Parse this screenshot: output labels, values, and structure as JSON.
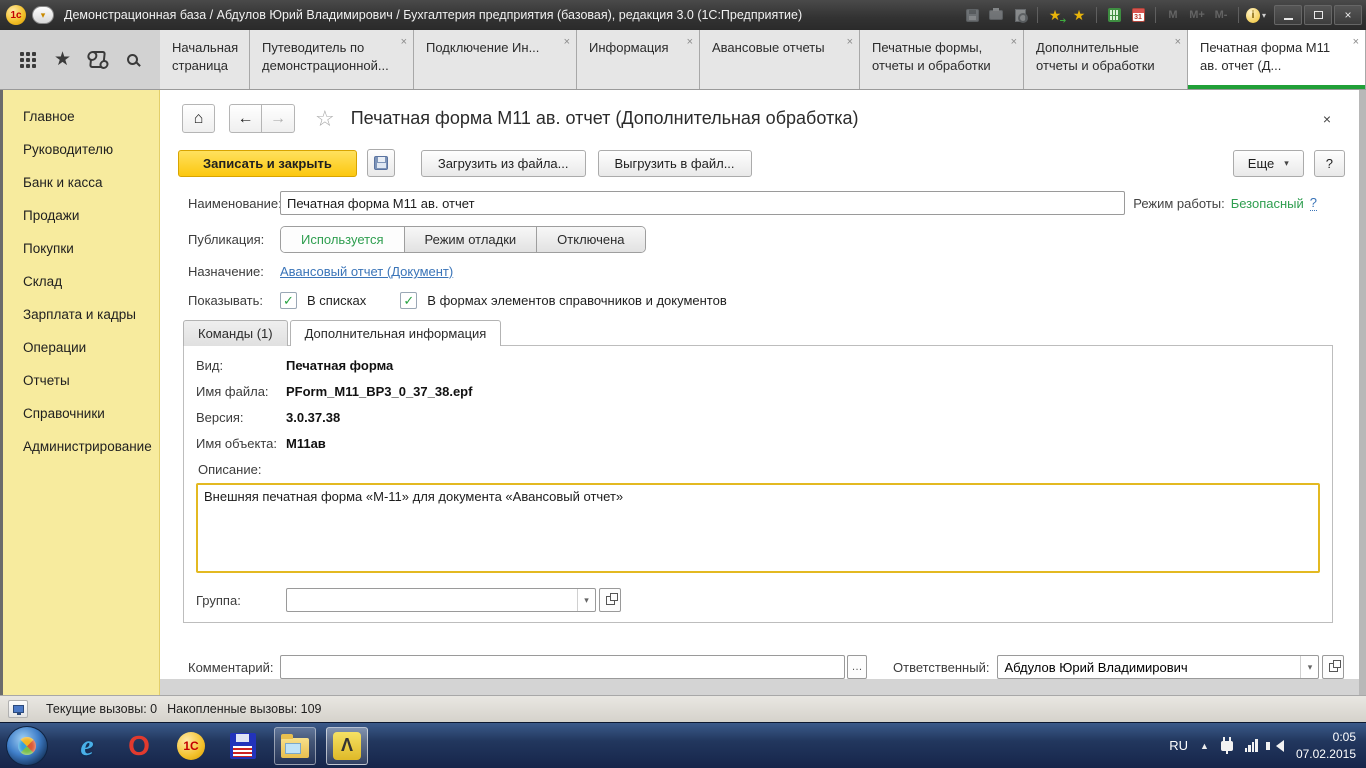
{
  "colors": {
    "accent_green": "#21a038",
    "sidebar_yellow": "#f7eb9e",
    "primary_button_yellow": "#fcc80f",
    "link_blue": "#3a74b8"
  },
  "icons": {
    "close": "×",
    "dropdown_caret": "▾",
    "back": "←",
    "forward": "→",
    "home": "⌂",
    "star": "★",
    "star_outline": "☆",
    "check": "✓",
    "info": "i",
    "calendar_day": "31",
    "ellipsis": "…",
    "question": "?"
  },
  "titlebar": {
    "title": "Демонстрационная база / Абдулов Юрий Владимирович / Бухгалтерия предприятия (базовая), редакция 3.0  (1С:Предприятие)",
    "logo": "1с",
    "memory_buttons": [
      "M",
      "M+",
      "M-"
    ]
  },
  "tabbar": {
    "tabs": [
      {
        "label": "Начальная страница"
      },
      {
        "label": "Путеводитель по демонстрационной..."
      },
      {
        "label": "Подключение Ин..."
      },
      {
        "label": "Информация"
      },
      {
        "label": "Авансовые отчеты"
      },
      {
        "label": "Печатные формы, отчеты и обработки"
      },
      {
        "label": "Дополнительные отчеты и обработки"
      },
      {
        "label": "Печатная форма М11 ав. отчет (Д..."
      }
    ]
  },
  "sidebar": {
    "items": [
      "Главное",
      "Руководителю",
      "Банк и касса",
      "Продажи",
      "Покупки",
      "Склад",
      "Зарплата и кадры",
      "Операции",
      "Отчеты",
      "Справочники",
      "Администрирование"
    ]
  },
  "form": {
    "title": "Печатная форма М11 ав. отчет (Дополнительная обработка)",
    "toolbar": {
      "save_close": "Записать и закрыть",
      "load_from_file": "Загрузить из файла...",
      "unload_to_file": "Выгрузить в файл...",
      "more": "Еще",
      "help": "?"
    },
    "name_label": "Наименование:",
    "name_value": "Печатная форма М11 ав. отчет",
    "mode_label": "Режим работы:",
    "mode_value": "Безопасный",
    "mode_help": "?",
    "publication_label": "Публикация:",
    "publication_options": [
      "Используется",
      "Режим отладки",
      "Отключена"
    ],
    "purpose_label": "Назначение:",
    "purpose_link": "Авансовый отчет (Документ)",
    "show_label": "Показывать:",
    "show_option1": "В списках",
    "show_option2": "В формах элементов справочников и документов",
    "inner_tabs": [
      "Команды (1)",
      "Дополнительная информация"
    ],
    "info": {
      "kind_label": "Вид:",
      "kind_value": "Печатная форма",
      "file_label": "Имя файла:",
      "file_value": "PForm_M11_BP3_0_37_38.epf",
      "version_label": "Версия:",
      "version_value": "3.0.37.38",
      "object_label": "Имя объекта:",
      "object_value": "М11ав",
      "description_label": "Описание:",
      "description_value": "Внешняя печатная форма «М-11» для документа «Авансовый отчет»",
      "group_label": "Группа:",
      "group_value": ""
    },
    "comment_label": "Комментарий:",
    "comment_value": "",
    "responsible_label": "Ответственный:",
    "responsible_value": "Абдулов Юрий Владимирович"
  },
  "statusbar": {
    "current_calls": "Текущие вызовы: 0",
    "accumulated_calls": "Накопленные вызовы: 109"
  },
  "taskbar": {
    "tray_lang": "RU",
    "time": "0:05",
    "date": "07.02.2015"
  }
}
